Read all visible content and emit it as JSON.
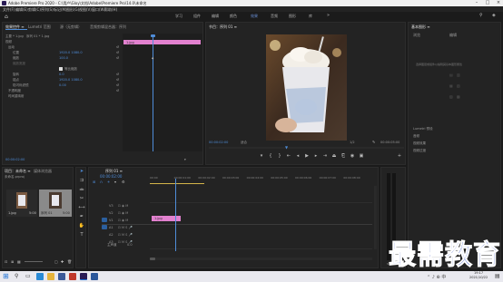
{
  "window": {
    "title": "Adobe Premiere Pro 2020 - C:\\用户\\Gloy\\文档\\Adobe\\Premiere Pro\\14.0\\未命名"
  },
  "menu": [
    "文件(F)",
    "编辑(E)",
    "剪辑(C)",
    "序列(S)",
    "标记(M)",
    "图形(G)",
    "视图(V)",
    "窗口(W)",
    "帮助(H)"
  ],
  "workspaces": [
    {
      "label": "学习",
      "active": false
    },
    {
      "label": "组件",
      "active": false
    },
    {
      "label": "编辑",
      "active": false
    },
    {
      "label": "颜色",
      "active": false
    },
    {
      "label": "效果",
      "active": true
    },
    {
      "label": "音频",
      "active": false
    },
    {
      "label": "图形",
      "active": false
    },
    {
      "label": "库",
      "active": false
    }
  ],
  "effect_controls": {
    "tabs": [
      "效果控件 ≡",
      "Lumetri 范围",
      "源（无剪辑）",
      "音频剪辑混合器：序列"
    ],
    "clip_label": "主要 * 1.jpg",
    "seq_label": "序列 01 * 1.jpg",
    "section_video": "视频",
    "fx_motion": "运动",
    "position_label": "位置",
    "position_val": "1920.0   1080.0",
    "scale_label": "缩放",
    "scale_val": "100.0",
    "scale_width_label": "缩放宽度",
    "uniform_label": "等比缩放",
    "rotation_label": "旋转",
    "rotation_val": "0.0",
    "anchor_label": "锚点",
    "anchor_val": "1920.0   1080.0",
    "antiflicker_label": "防闪烁滤镜",
    "antiflicker_val": "0.00",
    "opacity_label": "不透明度",
    "remap_label": "时间重映射",
    "clip_bar_label": "1.jpg",
    "timecode": "00:00:02:00"
  },
  "program_monitor": {
    "tab": "节目：序列 01 ≡",
    "timecode": "00:00:02:00",
    "fit_label": "适合",
    "quality_label": "1/2",
    "duration": "00:00:05:00"
  },
  "effects_panel": {
    "title": "基本图形 ≡",
    "tabs": [
      "浏览",
      "编辑"
    ],
    "hint": "选择图层或组件以编辑其基本图形属性",
    "section_lumetri": "Lumetri 预设",
    "items": [
      "音频",
      "视频效果",
      "视频过渡"
    ]
  },
  "project_panel": {
    "tabs": [
      "项目：未命名 ≡",
      "媒体浏览器"
    ],
    "project_file": "未命名.prproj",
    "items": [
      {
        "name": "1.jpg",
        "duration": "5:00"
      },
      {
        "name": "序列 01",
        "duration": "5:00"
      }
    ]
  },
  "timeline": {
    "tab": "序列 01 ≡",
    "timecode": "00:00:02:00",
    "ruler": [
      "00:00",
      "00:00:01:00",
      "00:00:02:00",
      "00:00:03:00",
      "00:00:04:00",
      "00:00:05:00",
      "00:00:06:00",
      "00:00:07:00",
      "00:00:08:00"
    ],
    "video_tracks": [
      "V3",
      "V2",
      "V1"
    ],
    "audio_tracks": [
      "A1",
      "A2",
      "A3"
    ],
    "master_label": "主声道",
    "master_val": "0.0",
    "clip_label": "1.jpg",
    "playhead_fraction": 0.4
  },
  "taskbar": {
    "time": "19:17",
    "date": "2021/10/22"
  },
  "watermark": {
    "text": "最需教育"
  },
  "colors": {
    "accent": "#4f8dd9",
    "clip": "#e281cf",
    "watermark": "#1f3fbf"
  }
}
